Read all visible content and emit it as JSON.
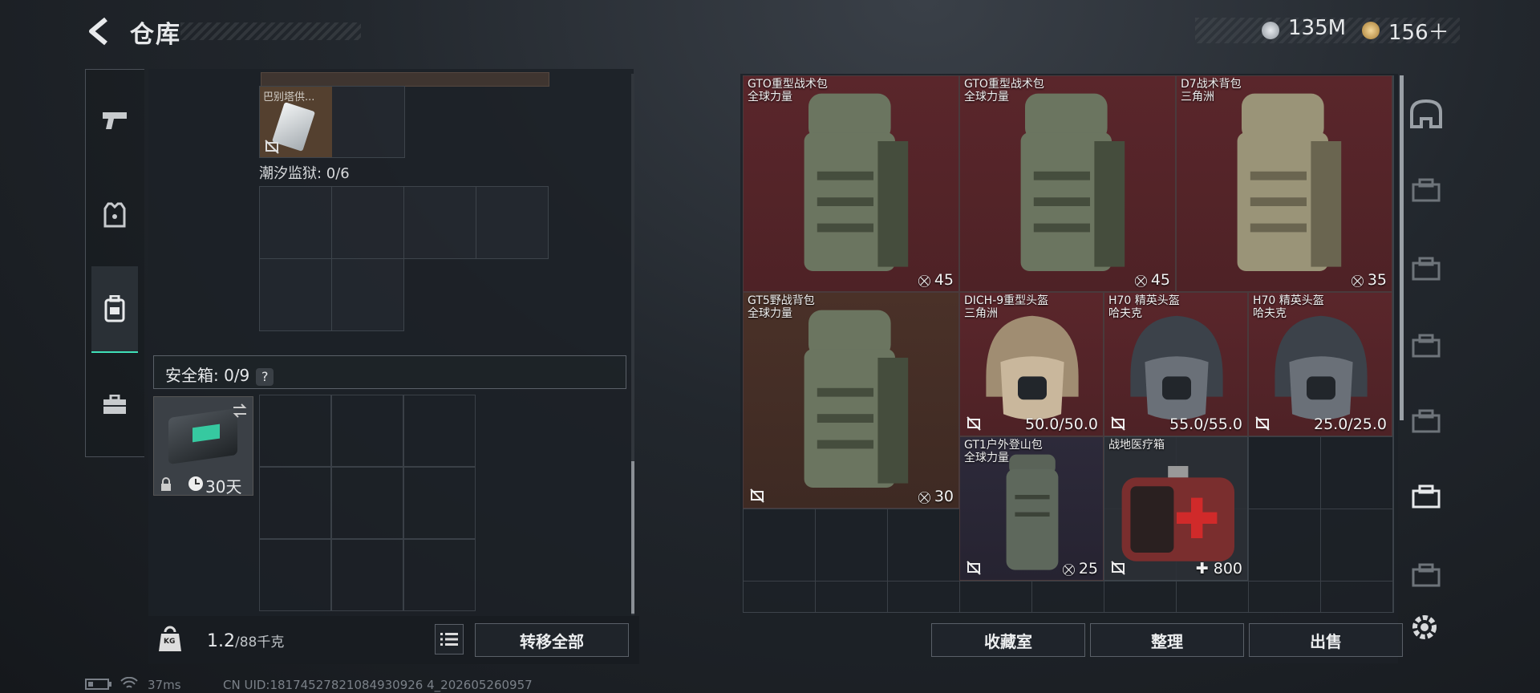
{
  "header": {
    "title": "仓库"
  },
  "currency": [
    {
      "amount": "135M",
      "icon": "silver-coin-icon",
      "color": "#c9ced4"
    },
    {
      "amount": "156＋",
      "icon": "gold-triangle-coin-icon",
      "color": "#d8b068"
    }
  ],
  "left_nav": [
    "pistol-icon",
    "armor-vest-icon",
    "backpack-icon",
    "toolbox-icon"
  ],
  "left_panel": {
    "top_item_name": "巴别塔供...",
    "zone_label": "潮汐监狱: 0/6",
    "safe_box_label": "安全箱: 0/9",
    "safe_box_help": "?",
    "safe_item_duration": "30天",
    "weight_value": "1.2",
    "weight_max": "/88千克",
    "weight_icon": "KG",
    "transfer_all": "转移全部"
  },
  "status_bar": {
    "ping": "37ms",
    "uid": "CN UID:18174527821084930926 4_202605260957"
  },
  "right_panel": {
    "items": [
      {
        "name": "GTO重型战术包",
        "sub": "全球力量",
        "value": "45",
        "kind": "backpack",
        "bg": "red"
      },
      {
        "name": "GTO重型战术包",
        "sub": "全球力量",
        "value": "45",
        "kind": "backpack",
        "bg": "red"
      },
      {
        "name": "D7战术背包",
        "sub": "三角洲",
        "value": "35",
        "kind": "backpack-tan",
        "bg": "red"
      },
      {
        "name": "GT5野战背包",
        "sub": "全球力量",
        "value": "30",
        "kind": "backpack",
        "bg": "brown"
      },
      {
        "name": "DICH-9重型头盔",
        "sub": "三角洲",
        "value": "50.0/50.0",
        "kind": "helmet-tan",
        "bg": "red"
      },
      {
        "name": "H70 精英头盔",
        "sub": "哈夫克",
        "value": "55.0/55.0",
        "kind": "helmet",
        "bg": "red"
      },
      {
        "name": "H70 精英头盔",
        "sub": "哈夫克",
        "value": "25.0/25.0",
        "kind": "helmet",
        "bg": "red"
      },
      {
        "name": "GT1户外登山包",
        "sub": "全球力量",
        "value": "25",
        "kind": "bag-small",
        "bg": "purple"
      },
      {
        "name": "战地医疗箱",
        "sub": "",
        "value": "800",
        "kind": "medkit",
        "bg": "grid"
      }
    ],
    "buttons": {
      "collection": "收藏室",
      "sort": "整理",
      "sell": "出售"
    }
  },
  "right_nav": [
    "helmet-slot-icon",
    "armor-iv-icon",
    "rig-v-icon",
    "rig-v2-icon",
    "gti-icon",
    "gti-active-icon",
    "armor-iv-2-icon",
    "settings-gear-icon"
  ]
}
